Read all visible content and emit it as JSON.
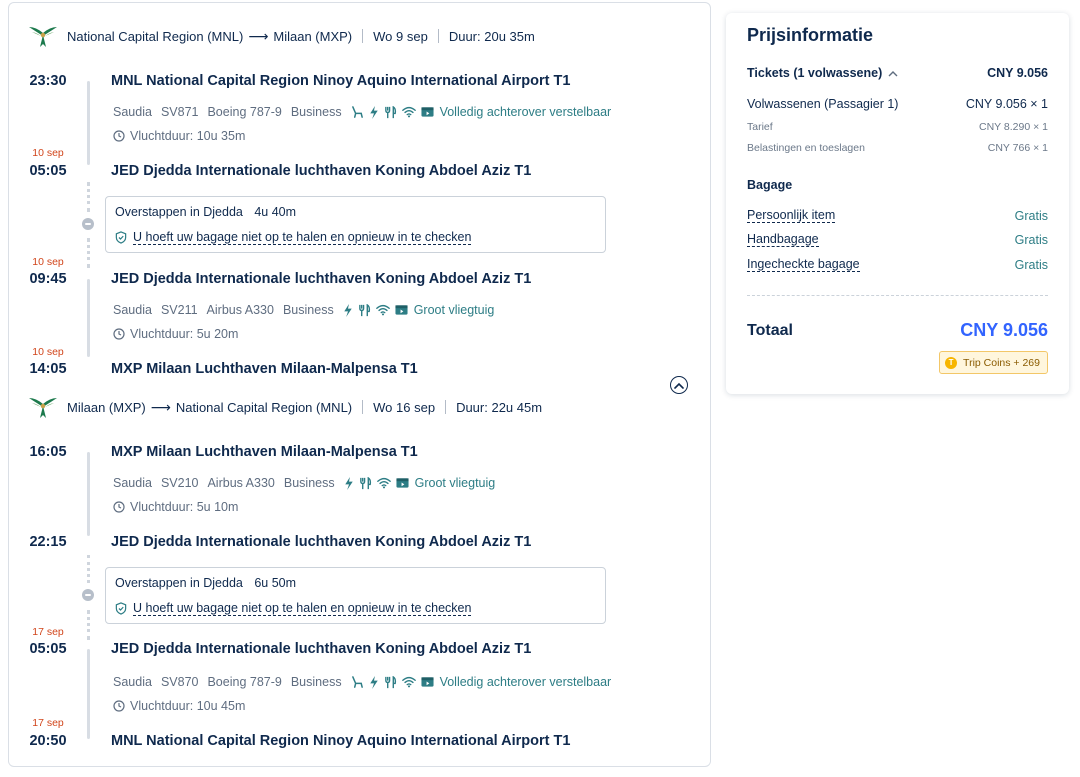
{
  "colors": {
    "accent": "#3264ff",
    "teal": "#2d7d85",
    "date_note": "#d1451b",
    "text": "#0f294d"
  },
  "outbound": {
    "header": {
      "from": "National Capital Region (MNL)",
      "arrow": "⟶",
      "to": "Milaan (MXP)",
      "date": "Wo 9 sep",
      "duration": "Duur: 20u 35m"
    },
    "seg1": {
      "dep_time": "23:30",
      "dep_airport": "MNL National Capital Region Ninoy Aquino International Airport T1",
      "airline": "Saudia",
      "flight": "SV871",
      "aircraft": "Boeing 787-9",
      "cabin": "Business",
      "amenity_icons": [
        "seat-recline-icon",
        "power-icon",
        "meal-icon",
        "wifi-icon",
        "entertainment-icon"
      ],
      "amenity_text": "Volledig achterover verstelbaar",
      "flight_duration": "Vluchtduur: 10u 35m",
      "arr_date_note": "10 sep",
      "arr_time": "05:05",
      "arr_airport": "JED Djedda Internationale luchthaven Koning Abdoel Aziz T1"
    },
    "transfer": {
      "label": "Overstappen in Djedda",
      "duration": "4u 40m",
      "baggage_note": "U hoeft uw bagage niet op te halen en opnieuw in te checken"
    },
    "seg2": {
      "dep_date_note": "10 sep",
      "dep_time": "09:45",
      "dep_airport": "JED Djedda Internationale luchthaven Koning Abdoel Aziz T1",
      "airline": "Saudia",
      "flight": "SV211",
      "aircraft": "Airbus A330",
      "cabin": "Business",
      "amenity_icons": [
        "power-icon",
        "meal-icon",
        "wifi-icon",
        "entertainment-icon"
      ],
      "amenity_text": "Groot vliegtuig",
      "flight_duration": "Vluchtduur: 5u 20m",
      "arr_date_note": "10 sep",
      "arr_time": "14:05",
      "arr_airport": "MXP Milaan Luchthaven Milaan-Malpensa T1"
    }
  },
  "inbound": {
    "header": {
      "from": "Milaan (MXP)",
      "arrow": "⟶",
      "to": "National Capital Region (MNL)",
      "date": "Wo 16 sep",
      "duration": "Duur: 22u 45m"
    },
    "seg1": {
      "dep_time": "16:05",
      "dep_airport": "MXP Milaan Luchthaven Milaan-Malpensa T1",
      "airline": "Saudia",
      "flight": "SV210",
      "aircraft": "Airbus A330",
      "cabin": "Business",
      "amenity_icons": [
        "power-icon",
        "meal-icon",
        "wifi-icon",
        "entertainment-icon"
      ],
      "amenity_text": "Groot vliegtuig",
      "flight_duration": "Vluchtduur: 5u 10m",
      "arr_time": "22:15",
      "arr_airport": "JED Djedda Internationale luchthaven Koning Abdoel Aziz T1"
    },
    "transfer": {
      "label": "Overstappen in Djedda",
      "duration": "6u 50m",
      "baggage_note": "U hoeft uw bagage niet op te halen en opnieuw in te checken"
    },
    "seg2": {
      "dep_date_note": "17 sep",
      "dep_time": "05:05",
      "dep_airport": "JED Djedda Internationale luchthaven Koning Abdoel Aziz T1",
      "airline": "Saudia",
      "flight": "SV870",
      "aircraft": "Boeing 787-9",
      "cabin": "Business",
      "amenity_icons": [
        "seat-recline-icon",
        "power-icon",
        "meal-icon",
        "wifi-icon",
        "entertainment-icon"
      ],
      "amenity_text": "Volledig achterover verstelbaar",
      "flight_duration": "Vluchtduur: 10u 45m",
      "arr_date_note": "17 sep",
      "arr_time": "20:50",
      "arr_airport": "MNL National Capital Region Ninoy Aquino International Airport T1"
    }
  },
  "price": {
    "title": "Prijsinformatie",
    "tickets_label": "Tickets (1 volwassene)",
    "tickets_total": "CNY 9.056",
    "adult_label": "Volwassenen (Passagier 1)",
    "adult_value": "CNY 9.056 × 1",
    "fare_label": "Tarief",
    "fare_value": "CNY 8.290 × 1",
    "tax_label": "Belastingen en toeslagen",
    "tax_value": "CNY 766 × 1",
    "baggage_title": "Bagage",
    "baggage": [
      {
        "label": "Persoonlijk item",
        "value": "Gratis"
      },
      {
        "label": "Handbagage",
        "value": "Gratis"
      },
      {
        "label": "Ingecheckte bagage",
        "value": "Gratis"
      }
    ],
    "total_label": "Totaal",
    "total_value": "CNY 9.056",
    "coins": "Trip Coins + 269",
    "coin_glyph": "T"
  }
}
